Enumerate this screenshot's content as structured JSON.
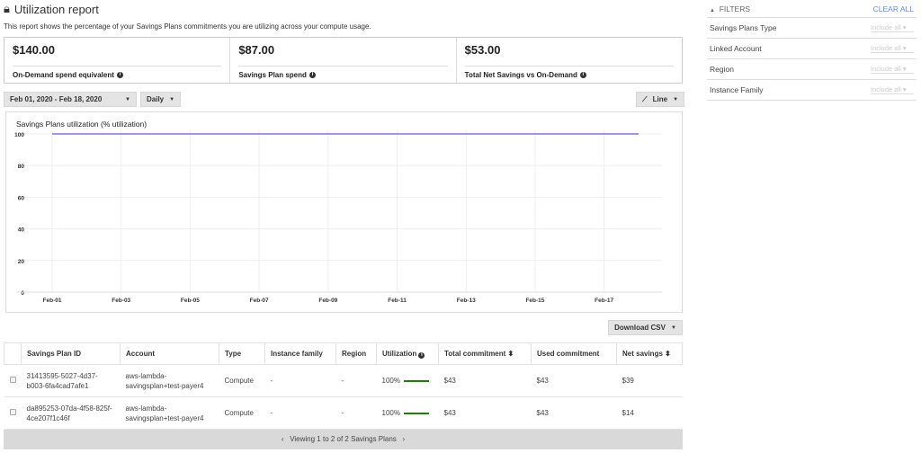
{
  "header": {
    "title": "Utilization report",
    "description": "This report shows the percentage of your Savings Plans commitments you are utilizing across your compute usage."
  },
  "cards": [
    {
      "value": "$140.00",
      "label": "On-Demand spend equivalent"
    },
    {
      "value": "$87.00",
      "label": "Savings Plan spend"
    },
    {
      "value": "$53.00",
      "label": "Total Net Savings vs On-Demand"
    }
  ],
  "controls": {
    "date_range": "Feb 01, 2020 - Feb 18, 2020",
    "granularity": "Daily",
    "chart_type": "Line",
    "download": "Download CSV"
  },
  "chart_data": {
    "type": "line",
    "title": "Savings Plans utilization (% utilization)",
    "x": [
      "Feb-01",
      "Feb-02",
      "Feb-03",
      "Feb-04",
      "Feb-05",
      "Feb-06",
      "Feb-07",
      "Feb-08",
      "Feb-09",
      "Feb-10",
      "Feb-11",
      "Feb-12",
      "Feb-13",
      "Feb-14",
      "Feb-15",
      "Feb-16",
      "Feb-17",
      "Feb-18"
    ],
    "series": [
      {
        "name": "Utilization",
        "values": [
          100,
          100,
          100,
          100,
          100,
          100,
          100,
          100,
          100,
          100,
          100,
          100,
          100,
          100,
          100,
          100,
          100,
          100
        ],
        "color": "#8c6cf0"
      }
    ],
    "xticks": [
      "Feb-01",
      "Feb-03",
      "Feb-05",
      "Feb-07",
      "Feb-09",
      "Feb-11",
      "Feb-13",
      "Feb-15",
      "Feb-17"
    ],
    "yticks": [
      "0",
      "20",
      "40",
      "60",
      "80",
      "100"
    ],
    "ylim": [
      0,
      100
    ],
    "grid": true
  },
  "table": {
    "columns": [
      "Savings Plan ID",
      "Account",
      "Type",
      "Instance family",
      "Region",
      "Utilization",
      "Total commitment",
      "Used commitment",
      "Net savings"
    ],
    "rows": [
      [
        "31413595-5027-4d37-b003-6fa4cad7afe1",
        "aws-lambda-savingsplan+test-payer4",
        "Compute",
        "-",
        "-",
        "100%",
        "$43",
        "$43",
        "$39"
      ],
      [
        "da895253-07da-4f58-825f-4ce207f1c46f",
        "aws-lambda-savingsplan+test-payer4",
        "Compute",
        "-",
        "-",
        "100%",
        "$43",
        "$43",
        "$14"
      ]
    ],
    "footer": "Viewing 1 to 2 of 2 Savings Plans"
  },
  "filters": {
    "title": "FILTERS",
    "clear": "CLEAR ALL",
    "items": [
      {
        "label": "Savings Plans Type",
        "value": "Include all"
      },
      {
        "label": "Linked Account",
        "value": "Include all"
      },
      {
        "label": "Region",
        "value": "Include all"
      },
      {
        "label": "Instance Family",
        "value": "Include all"
      }
    ]
  }
}
